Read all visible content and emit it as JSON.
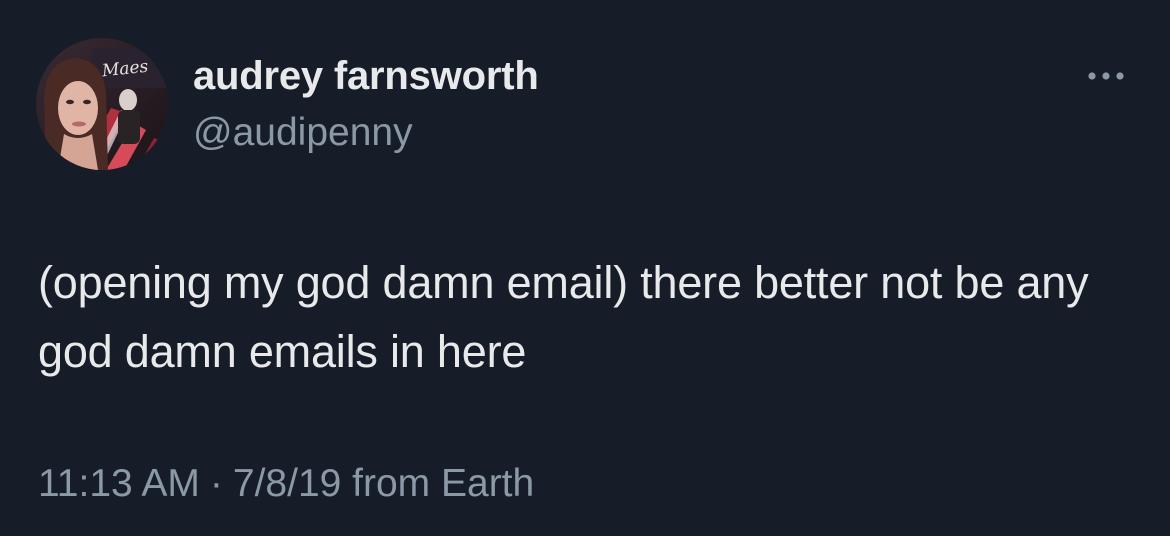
{
  "author": {
    "display_name": "audrey farnsworth",
    "handle": "@audipenny",
    "avatar_icon": "profile-photo-avatar",
    "avatar_sign_text": "Maes"
  },
  "tweet": {
    "text": "(opening my god damn email) there better not be any god damn emails in here",
    "time": "11:13 AM",
    "separator": "·",
    "date_source": "7/8/19 from Earth"
  },
  "more_menu": {
    "icon": "more-horizontal-icon"
  },
  "colors": {
    "background": "#171d28",
    "primary_text": "#e7e9ea",
    "secondary_text": "#8b98a5"
  }
}
